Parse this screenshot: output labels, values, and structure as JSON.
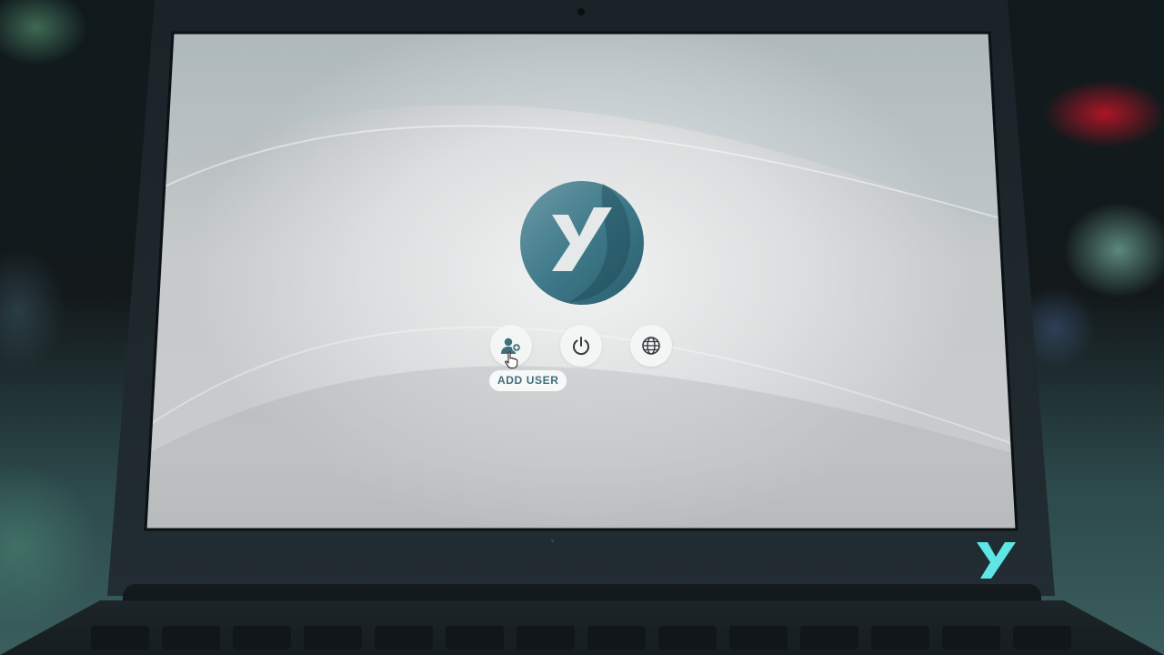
{
  "login_screen": {
    "logo": {
      "icon": "y-logo-icon",
      "colors": {
        "primary": "#3f7a8a",
        "dark": "#2a5c6b",
        "letter": "#e6e9ea"
      }
    },
    "actions": [
      {
        "id": "add-user",
        "icon": "add-user-icon",
        "tooltip": "ADD USER"
      },
      {
        "id": "power",
        "icon": "power-icon"
      },
      {
        "id": "language",
        "icon": "globe-icon"
      }
    ],
    "accent_color": "#3f6f7c"
  },
  "laptop": {
    "bezel_logo": {
      "icon": "y-brand-icon",
      "color": "#5ee6e6"
    }
  }
}
